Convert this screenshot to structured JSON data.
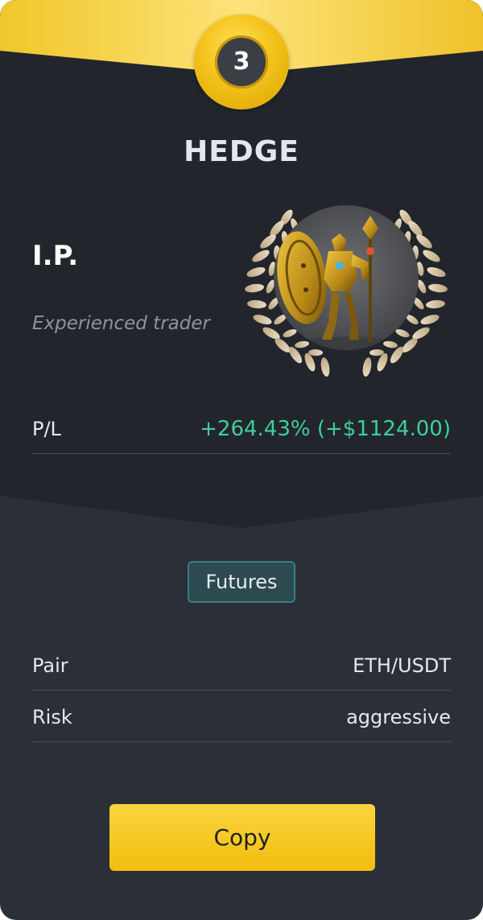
{
  "card": {
    "rank": "3",
    "strategy_title": "HEDGE",
    "trader_name": "I.P.",
    "trader_description": "Experienced trader",
    "avatar_icon": "golden-armored-warrior-avatar",
    "laurel_icon": "laurel-wreath-icon"
  },
  "performance": {
    "label": "P/L",
    "value": "+264.43% (+$1124.00)"
  },
  "market": {
    "type": "Futures"
  },
  "details": [
    {
      "label": "Pair",
      "value": "ETH/USDT"
    },
    {
      "label": "Risk",
      "value": "aggressive"
    }
  ],
  "actions": {
    "copy_label": "Copy"
  },
  "colors": {
    "background_bottom": "#2b2f37",
    "background_top": "#22252c",
    "gold": "#f3c21a",
    "profit_green": "#3ecf9b",
    "chip_border": "#3a7f80"
  }
}
